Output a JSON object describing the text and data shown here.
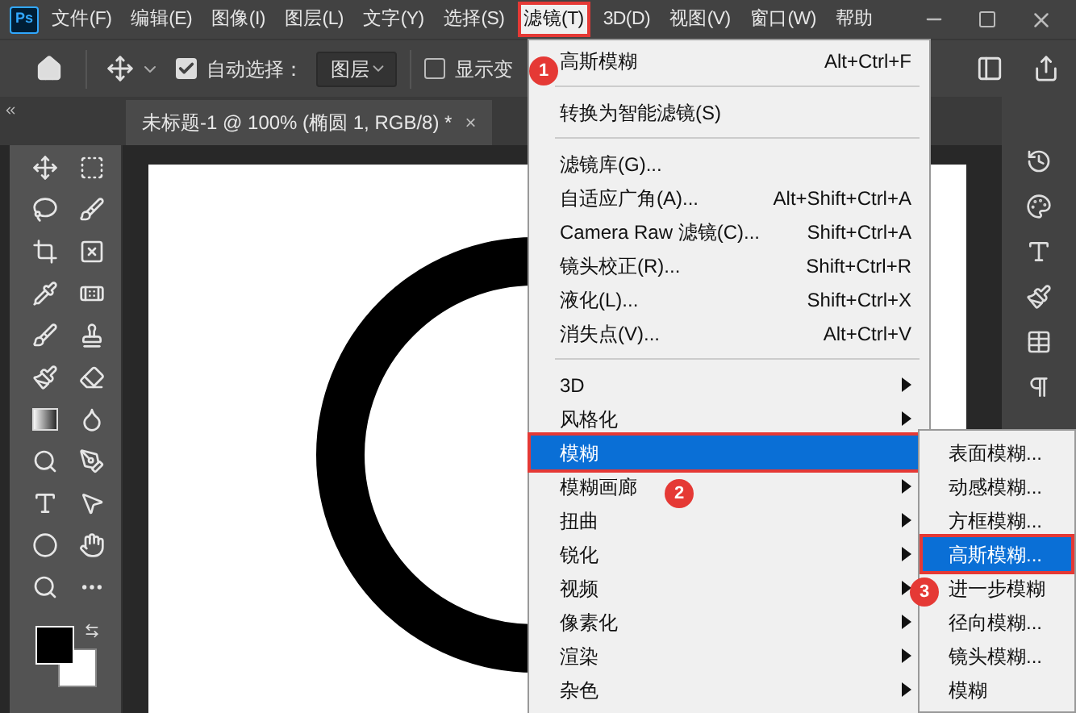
{
  "app_logo": "Ps",
  "menu_bar": [
    {
      "label": "文件(F)",
      "selected": false
    },
    {
      "label": "编辑(E)",
      "selected": false
    },
    {
      "label": "图像(I)",
      "selected": false
    },
    {
      "label": "图层(L)",
      "selected": false
    },
    {
      "label": "文字(Y)",
      "selected": false
    },
    {
      "label": "选择(S)",
      "selected": false
    },
    {
      "label": "滤镜(T)",
      "selected": true
    },
    {
      "label": "3D(D)",
      "selected": false
    },
    {
      "label": "视图(V)",
      "selected": false
    },
    {
      "label": "窗口(W)",
      "selected": false
    },
    {
      "label": "帮助",
      "selected": false
    }
  ],
  "options_bar": {
    "auto_select": {
      "label": "自动选择：",
      "checked": true
    },
    "target_dropdown": "图层",
    "show_transform": {
      "label": "显示变",
      "checked": false
    }
  },
  "document_tab": {
    "title": "未标题-1 @ 100% (椭圆 1, RGB/8) *",
    "close": "×"
  },
  "filter_menu": [
    {
      "kind": "item",
      "label": "高斯模糊",
      "shortcut": "Alt+Ctrl+F",
      "selected": false
    },
    {
      "kind": "separator"
    },
    {
      "kind": "item",
      "label": "转换为智能滤镜(S)",
      "selected": false
    },
    {
      "kind": "separator"
    },
    {
      "kind": "item",
      "label": "滤镜库(G)...",
      "selected": false
    },
    {
      "kind": "item",
      "label": "自适应广角(A)...",
      "shortcut": "Alt+Shift+Ctrl+A",
      "selected": false
    },
    {
      "kind": "item",
      "label": "Camera Raw 滤镜(C)...",
      "shortcut": "Shift+Ctrl+A",
      "selected": false
    },
    {
      "kind": "item",
      "label": "镜头校正(R)...",
      "shortcut": "Shift+Ctrl+R",
      "selected": false
    },
    {
      "kind": "item",
      "label": "液化(L)...",
      "shortcut": "Shift+Ctrl+X",
      "selected": false
    },
    {
      "kind": "item",
      "label": "消失点(V)...",
      "shortcut": "Alt+Ctrl+V",
      "selected": false
    },
    {
      "kind": "separator"
    },
    {
      "kind": "submenu",
      "label": "3D",
      "selected": false
    },
    {
      "kind": "submenu",
      "label": "风格化",
      "selected": false
    },
    {
      "kind": "submenu",
      "label": "模糊",
      "selected": true
    },
    {
      "kind": "submenu",
      "label": "模糊画廊",
      "selected": false
    },
    {
      "kind": "submenu",
      "label": "扭曲",
      "selected": false
    },
    {
      "kind": "submenu",
      "label": "锐化",
      "selected": false
    },
    {
      "kind": "submenu",
      "label": "视频",
      "selected": false
    },
    {
      "kind": "submenu",
      "label": "像素化",
      "selected": false
    },
    {
      "kind": "submenu",
      "label": "渲染",
      "selected": false
    },
    {
      "kind": "submenu",
      "label": "杂色",
      "selected": false
    }
  ],
  "blur_submenu": [
    {
      "label": "表面模糊...",
      "selected": false
    },
    {
      "label": "动感模糊...",
      "selected": false
    },
    {
      "label": "方框模糊...",
      "selected": false
    },
    {
      "label": "高斯模糊...",
      "selected": true
    },
    {
      "label": "进一步模糊",
      "selected": false
    },
    {
      "label": "径向模糊...",
      "selected": false
    },
    {
      "label": "镜头模糊...",
      "selected": false
    },
    {
      "label": "模糊",
      "selected": false
    }
  ],
  "step_markers": [
    {
      "label": "1"
    },
    {
      "label": "2"
    },
    {
      "label": "3"
    }
  ]
}
